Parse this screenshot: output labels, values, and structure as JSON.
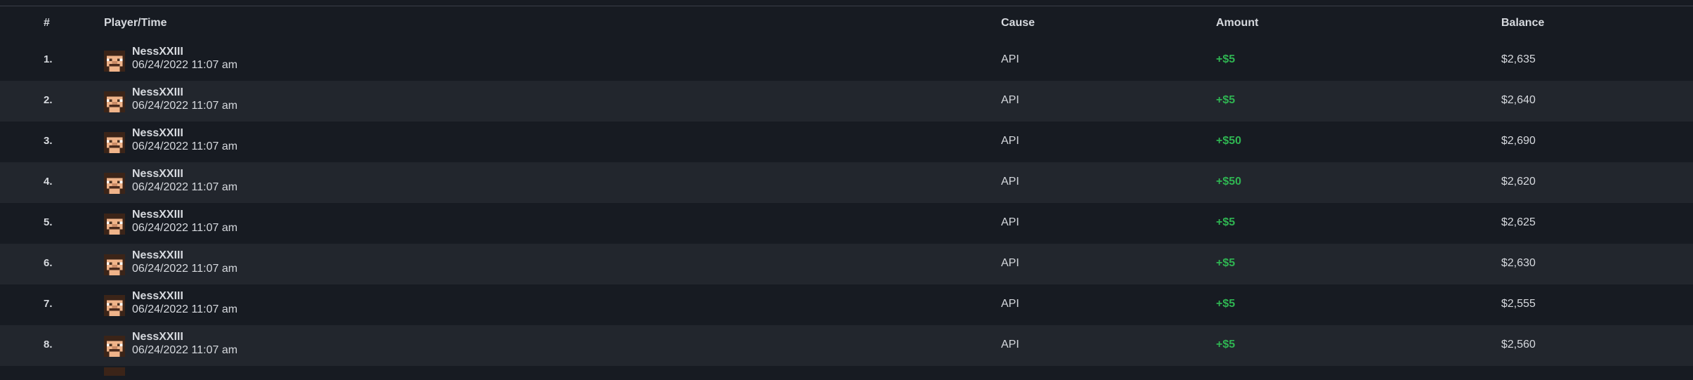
{
  "columns": {
    "num": "#",
    "player": "Player/Time",
    "cause": "Cause",
    "amount": "Amount",
    "balance": "Balance"
  },
  "colors": {
    "background": "#171b22",
    "row_alt": "#22262d",
    "amount_positive": "#2fb552",
    "text": "#d6d9de"
  },
  "rows": [
    {
      "num": "1.",
      "player": "NessXXIII",
      "time": "06/24/2022 11:07 am",
      "cause": "API",
      "amount": "+$5",
      "balance": "$2,635",
      "avatar": "player-skin-icon"
    },
    {
      "num": "2.",
      "player": "NessXXIII",
      "time": "06/24/2022 11:07 am",
      "cause": "API",
      "amount": "+$5",
      "balance": "$2,640",
      "avatar": "player-skin-icon"
    },
    {
      "num": "3.",
      "player": "NessXXIII",
      "time": "06/24/2022 11:07 am",
      "cause": "API",
      "amount": "+$50",
      "balance": "$2,690",
      "avatar": "player-skin-icon"
    },
    {
      "num": "4.",
      "player": "NessXXIII",
      "time": "06/24/2022 11:07 am",
      "cause": "API",
      "amount": "+$50",
      "balance": "$2,620",
      "avatar": "player-skin-icon"
    },
    {
      "num": "5.",
      "player": "NessXXIII",
      "time": "06/24/2022 11:07 am",
      "cause": "API",
      "amount": "+$5",
      "balance": "$2,625",
      "avatar": "player-skin-icon"
    },
    {
      "num": "6.",
      "player": "NessXXIII",
      "time": "06/24/2022 11:07 am",
      "cause": "API",
      "amount": "+$5",
      "balance": "$2,630",
      "avatar": "player-skin-icon"
    },
    {
      "num": "7.",
      "player": "NessXXIII",
      "time": "06/24/2022 11:07 am",
      "cause": "API",
      "amount": "+$5",
      "balance": "$2,555",
      "avatar": "player-skin-icon"
    },
    {
      "num": "8.",
      "player": "NessXXIII",
      "time": "06/24/2022 11:07 am",
      "cause": "API",
      "amount": "+$5",
      "balance": "$2,560",
      "avatar": "player-skin-icon"
    }
  ]
}
